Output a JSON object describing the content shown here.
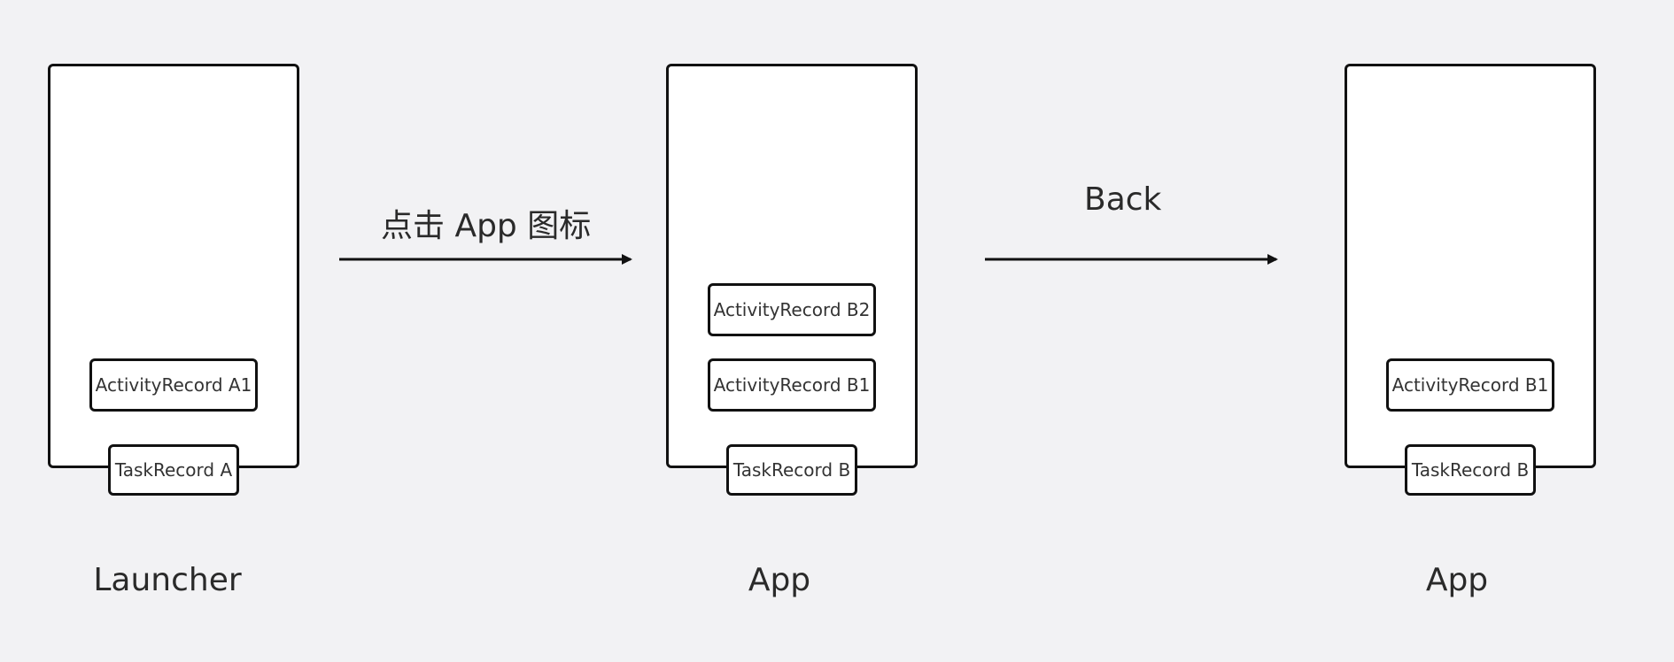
{
  "stages": [
    {
      "caption": "Launcher",
      "activities": [
        "ActivityRecord A1"
      ],
      "task": "TaskRecord A"
    },
    {
      "caption": "App",
      "activities": [
        "ActivityRecord B2",
        "ActivityRecord B1"
      ],
      "task": "TaskRecord B"
    },
    {
      "caption": "App",
      "activities": [
        "ActivityRecord B1"
      ],
      "task": "TaskRecord B"
    }
  ],
  "transitions": [
    {
      "label": "点击 App 图标"
    },
    {
      "label": "Back"
    }
  ],
  "colors": {
    "background": "#f2f2f4",
    "stroke": "#111111",
    "box_fill": "#ffffff"
  }
}
